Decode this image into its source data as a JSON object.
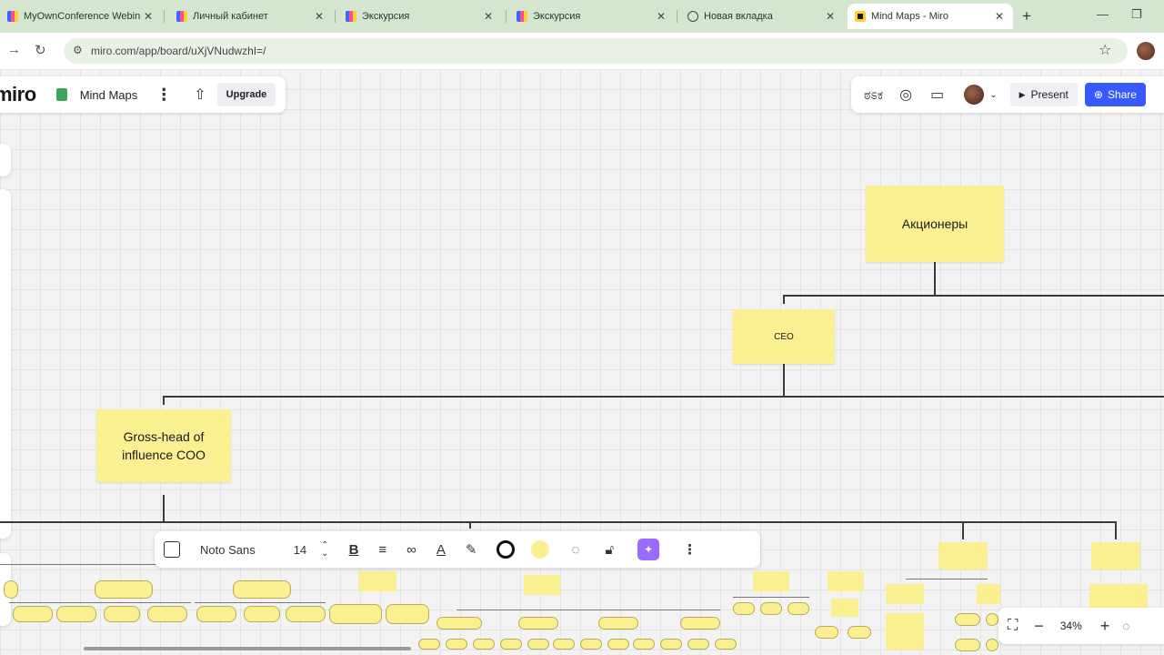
{
  "browser": {
    "tabs": [
      {
        "title": "MyOwnConference Webin",
        "icon": "miro-icon"
      },
      {
        "title": "Личный кабинет",
        "icon": "miro-icon"
      },
      {
        "title": "Экскурсия",
        "icon": "miro-icon"
      },
      {
        "title": "Экскурсия",
        "icon": "miro-icon"
      },
      {
        "title": "Новая вкладка",
        "icon": "globe-icon"
      },
      {
        "title": "Mind Maps - Miro",
        "icon": "miro-board-icon",
        "active": true
      }
    ],
    "close_glyph": "✕",
    "new_tab": "+",
    "minimize": "—",
    "maximize": "❐",
    "back": "→",
    "reload": "↻",
    "url": "miro.com/app/board/uXjVNudwzhI=/"
  },
  "board": {
    "logo": "miro",
    "name": "Mind Maps",
    "kebab": "⋮",
    "upload": "⇪",
    "upgrade_label": "Upgrade"
  },
  "collab": {
    "reactions": "ಠಽಕ",
    "present_label": "Present",
    "share_label": "Share"
  },
  "mindmap": {
    "shareholders": "Акционеры",
    "ceo": "CEO",
    "coo": "Gross-head of influence COO"
  },
  "format_toolbar": {
    "font": "Noto Sans",
    "size": "14"
  },
  "zoom": {
    "value": "34%",
    "minus": "−",
    "plus": "+"
  },
  "colors": {
    "sticky": "#fbf091",
    "share": "#3859ff",
    "tabbar": "#d4e6d0"
  }
}
